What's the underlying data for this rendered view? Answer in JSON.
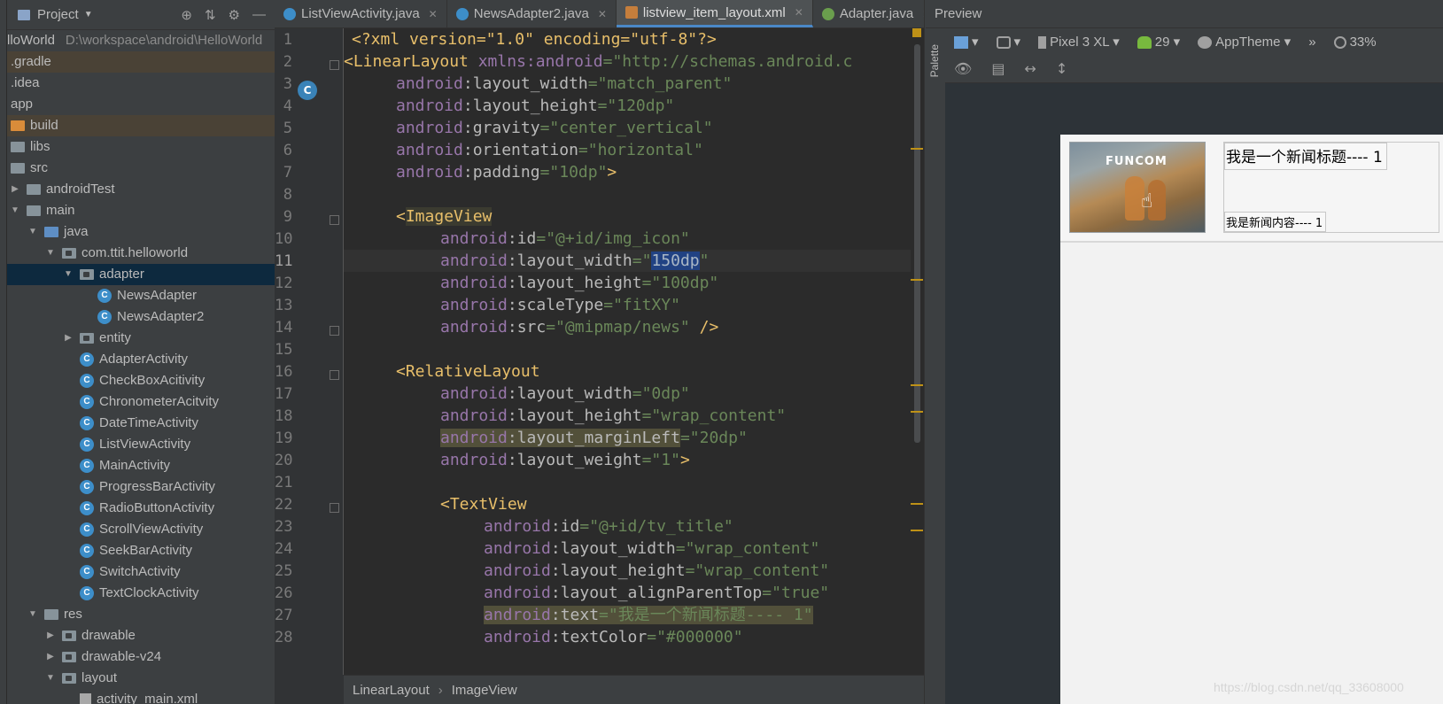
{
  "project": {
    "title": "Project",
    "tree": [
      {
        "label": "lloWorld",
        "path": "D:\\workspace\\android\\HelloWorld"
      },
      {
        "label": ".gradle"
      },
      {
        "label": ".idea"
      },
      {
        "label": "app"
      },
      {
        "label": "build"
      },
      {
        "label": "libs"
      },
      {
        "label": "src"
      },
      {
        "label": "androidTest"
      },
      {
        "label": "main"
      },
      {
        "label": "java"
      },
      {
        "label": "com.ttit.helloworld"
      },
      {
        "label": "adapter"
      },
      {
        "label": "NewsAdapter"
      },
      {
        "label": "NewsAdapter2"
      },
      {
        "label": "entity"
      },
      {
        "label": "AdapterActivity"
      },
      {
        "label": "CheckBoxAcitivity"
      },
      {
        "label": "ChronometerAcitvity"
      },
      {
        "label": "DateTimeActivity"
      },
      {
        "label": "ListViewActivity"
      },
      {
        "label": "MainActivity"
      },
      {
        "label": "ProgressBarActivity"
      },
      {
        "label": "RadioButtonActivity"
      },
      {
        "label": "ScrollViewActivity"
      },
      {
        "label": "SeekBarActivity"
      },
      {
        "label": "SwitchActivity"
      },
      {
        "label": "TextClockActivity"
      },
      {
        "label": "res"
      },
      {
        "label": "drawable"
      },
      {
        "label": "drawable-v24"
      },
      {
        "label": "layout"
      },
      {
        "label": "activity_main.xml"
      }
    ]
  },
  "tabs": [
    {
      "label": "ListViewActivity.java",
      "icon": "class-icon"
    },
    {
      "label": "NewsAdapter2.java",
      "icon": "class-icon"
    },
    {
      "label": "listview_item_layout.xml",
      "icon": "xml-file-icon"
    },
    {
      "label": "Adapter.java",
      "icon": "interface-icon"
    }
  ],
  "editor": {
    "line_numbers": [
      "1",
      "2",
      "3",
      "4",
      "5",
      "6",
      "7",
      "8",
      "9",
      "10",
      "11",
      "12",
      "13",
      "14",
      "15",
      "16",
      "17",
      "18",
      "19",
      "20",
      "21",
      "22",
      "23",
      "24",
      "25",
      "26",
      "27",
      "28"
    ],
    "current_line": 11,
    "code": {
      "l1": "<?xml version=\"1.0\" encoding=\"utf-8\"?>",
      "l2_tag": "<LinearLayout ",
      "l2_ns": "xmlns:android",
      "l2_val": "=\"http://schemas.android.c",
      "l3_ns": "android",
      "l3_attr": ":layout_width",
      "l3_val": "=\"match_parent\"",
      "l4_ns": "android",
      "l4_attr": ":layout_height",
      "l4_val": "=\"120dp\"",
      "l5_ns": "android",
      "l5_attr": ":gravity",
      "l5_val": "=\"center_vertical\"",
      "l6_ns": "android",
      "l6_attr": ":orientation",
      "l6_val": "=\"horizontal\"",
      "l7_ns": "android",
      "l7_attr": ":padding",
      "l7_val": "=\"10dp\"",
      "l7_end": ">",
      "l9_open": "<",
      "l9_tag": "ImageView",
      "l10_ns": "android",
      "l10_attr": ":id",
      "l10_val": "=\"@+id/img_icon\"",
      "l11_ns": "android",
      "l11_attr": ":layout_width",
      "l11_val_a": "=\"",
      "l11_sel": "150dp",
      "l11_val_b": "\"",
      "l12_ns": "android",
      "l12_attr": ":layout_height",
      "l12_val": "=\"100dp\"",
      "l13_ns": "android",
      "l13_attr": ":scaleType",
      "l13_val": "=\"fitXY\"",
      "l14_ns": "android",
      "l14_attr": ":src",
      "l14_val": "=\"@mipmap/news\"",
      "l14_end": " />",
      "l16_tag": "<RelativeLayout",
      "l17_ns": "android",
      "l17_attr": ":layout_width",
      "l17_val": "=\"0dp\"",
      "l18_ns": "android",
      "l18_attr": ":layout_height",
      "l18_val": "=\"wrap_content\"",
      "l19_ns": "android",
      "l19_attr": ":layout_marginLeft",
      "l19_val": "=\"20dp\"",
      "l20_ns": "android",
      "l20_attr": ":layout_weight",
      "l20_val": "=\"1\"",
      "l20_end": ">",
      "l22_tag": "<TextView",
      "l23_ns": "android",
      "l23_attr": ":id",
      "l23_val": "=\"@+id/tv_title\"",
      "l24_ns": "android",
      "l24_attr": ":layout_width",
      "l24_val": "=\"wrap_content\"",
      "l25_ns": "android",
      "l25_attr": ":layout_height",
      "l25_val": "=\"wrap_content\"",
      "l26_ns": "android",
      "l26_attr": ":layout_alignParentTop",
      "l26_val": "=\"true\"",
      "l27_ns": "android",
      "l27_attr": ":text",
      "l27_val": "=\"我是一个新闻标题---- 1\"",
      "l28_ns": "android",
      "l28_attr": ":textColor",
      "l28_val": "=\"#000000\""
    }
  },
  "breadcrumb": [
    "LinearLayout",
    "ImageView"
  ],
  "palette": {
    "label": "Palette"
  },
  "preview": {
    "title": "Preview",
    "device": "Pixel 3 XL",
    "api": "29",
    "theme": "AppTheme",
    "zoom": "33%",
    "item": {
      "image_logo": "FUNCOM",
      "title": "我是一个新闻标题---- 1",
      "content": "我是新闻内容---- 1"
    }
  },
  "watermark": "https://blog.csdn.net/qq_33608000"
}
